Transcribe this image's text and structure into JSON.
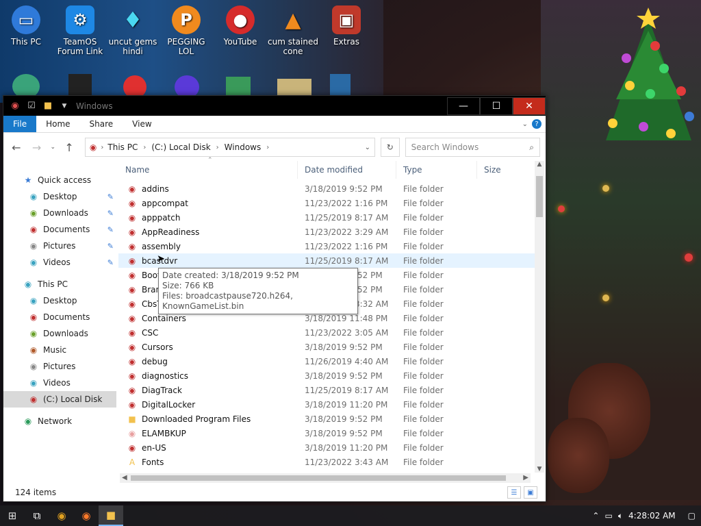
{
  "colors": {
    "ribbon_file_tab": "#1979ca",
    "close_button": "#c42b1c",
    "header_text": "#4c607a",
    "meta_text": "#6d6d6d"
  },
  "desktop": {
    "icons": [
      {
        "label": "This PC",
        "icon": "monitor-icon"
      },
      {
        "label": "TeamOS\nForum Link",
        "icon": "gear-icon"
      },
      {
        "label": "uncut gems\nhindi",
        "icon": "diamond-icon"
      },
      {
        "label": "PEGGING LOL",
        "icon": "p-logo-icon"
      },
      {
        "label": "YouTube",
        "icon": "angry-bird-icon"
      },
      {
        "label": "cum stained\ncone",
        "icon": "vlc-cone-icon"
      },
      {
        "label": "Extras",
        "icon": "gift-icon"
      }
    ]
  },
  "window": {
    "title": "Windows",
    "ribbon": {
      "tabs": [
        "File",
        "Home",
        "Share",
        "View"
      ]
    },
    "breadcrumb": [
      "This PC",
      "(C:) Local Disk",
      "Windows"
    ],
    "search_placeholder": "Search Windows",
    "columns": [
      "Name",
      "Date modified",
      "Type",
      "Size"
    ],
    "sidebar": {
      "quick_access_label": "Quick access",
      "quick_access": [
        "Desktop",
        "Downloads",
        "Documents",
        "Pictures",
        "Videos"
      ],
      "this_pc_label": "This PC",
      "this_pc": [
        "Desktop",
        "Documents",
        "Downloads",
        "Music",
        "Pictures",
        "Videos",
        "(C:) Local Disk"
      ],
      "network_label": "Network"
    },
    "files": [
      {
        "name": "addins",
        "date": "3/18/2019 9:52 PM",
        "type": "File folder"
      },
      {
        "name": "appcompat",
        "date": "11/23/2022 1:16 PM",
        "type": "File folder"
      },
      {
        "name": "apppatch",
        "date": "11/25/2019 8:17 AM",
        "type": "File folder"
      },
      {
        "name": "AppReadiness",
        "date": "11/23/2022 3:29 AM",
        "type": "File folder"
      },
      {
        "name": "assembly",
        "date": "11/23/2022 1:16 PM",
        "type": "File folder"
      },
      {
        "name": "bcastdvr",
        "date": "11/25/2019 8:17 AM",
        "type": "File folder"
      },
      {
        "name": "Boot",
        "date": "3/18/2019 9:52 PM",
        "type": "File folder"
      },
      {
        "name": "Branding",
        "date": "3/18/2019 9:52 PM",
        "type": "File folder"
      },
      {
        "name": "CbsTemp",
        "date": "11/23/2022 3:32 AM",
        "type": "File folder"
      },
      {
        "name": "Containers",
        "date": "3/18/2019 11:48 PM",
        "type": "File folder"
      },
      {
        "name": "CSC",
        "date": "11/23/2022 3:05 AM",
        "type": "File folder"
      },
      {
        "name": "Cursors",
        "date": "3/18/2019 9:52 PM",
        "type": "File folder"
      },
      {
        "name": "debug",
        "date": "11/26/2019 4:40 AM",
        "type": "File folder"
      },
      {
        "name": "diagnostics",
        "date": "3/18/2019 9:52 PM",
        "type": "File folder"
      },
      {
        "name": "DiagTrack",
        "date": "11/25/2019 8:17 AM",
        "type": "File folder"
      },
      {
        "name": "DigitalLocker",
        "date": "3/18/2019 11:20 PM",
        "type": "File folder"
      },
      {
        "name": "Downloaded Program Files",
        "date": "3/18/2019 9:52 PM",
        "type": "File folder"
      },
      {
        "name": "ELAMBKUP",
        "date": "3/18/2019 9:52 PM",
        "type": "File folder"
      },
      {
        "name": "en-US",
        "date": "3/18/2019 11:20 PM",
        "type": "File folder"
      },
      {
        "name": "Fonts",
        "date": "11/23/2022 3:43 AM",
        "type": "File folder"
      }
    ],
    "tooltip": {
      "line1": "Date created: 3/18/2019 9:52 PM",
      "line2": "Size: 766 KB",
      "line3": "Files: broadcastpause720.h264, KnownGameList.bin"
    },
    "status": "124 items"
  },
  "taskbar": {
    "time": "4:28:02 AM"
  }
}
